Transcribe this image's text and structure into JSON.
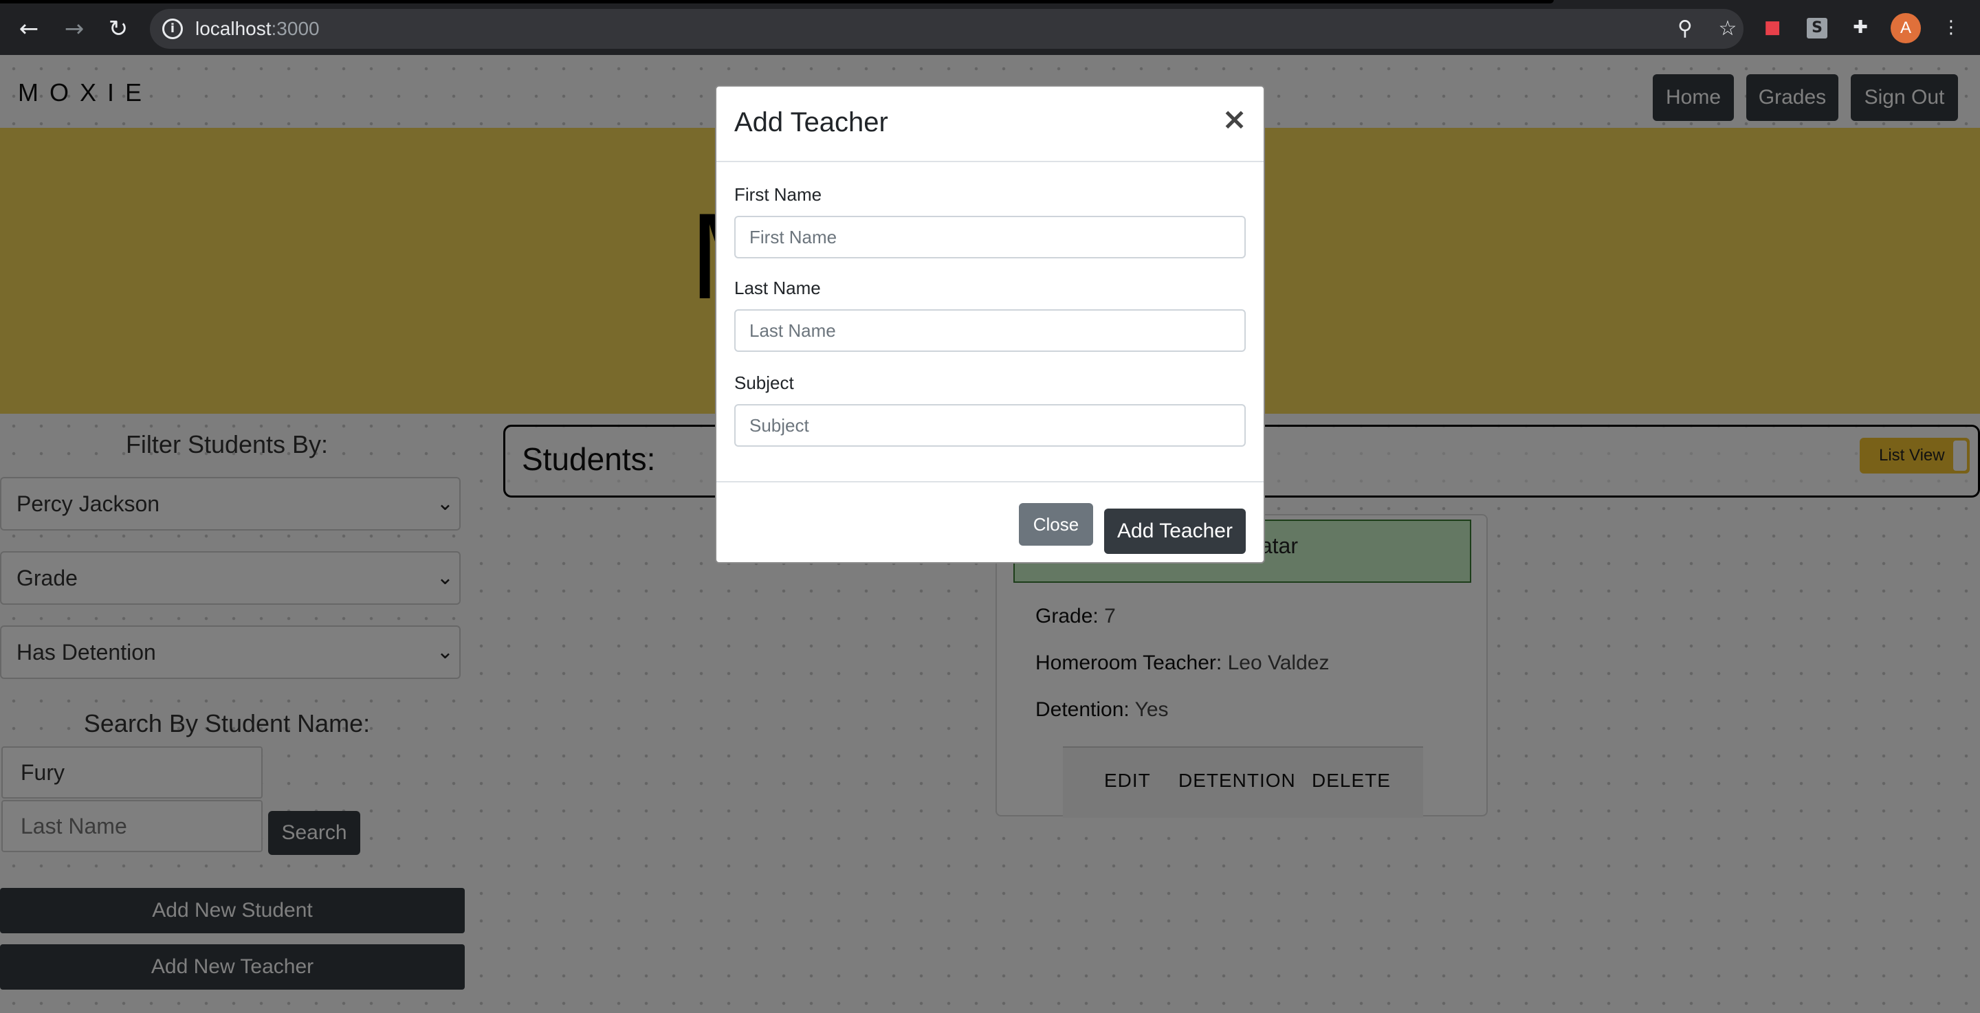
{
  "browser": {
    "url_host": "localhost",
    "url_port": ":3000",
    "profile_initial": "A",
    "ext_s_label": "S"
  },
  "navbar": {
    "brand": "MOXIE",
    "links": [
      "Home",
      "Grades",
      "Sign Out"
    ]
  },
  "hero": {
    "title": "MOXIE"
  },
  "filters": {
    "heading": "Filter Students By:",
    "selects": [
      "Percy Jackson",
      "Grade",
      "Has Detention"
    ],
    "search_heading": "Search By Student Name:",
    "first_name_value": "Fury",
    "last_name_placeholder": "Last Name",
    "search_label": "Search",
    "add_student_label": "Add New Student",
    "add_teacher_label": "Add New Teacher"
  },
  "students": {
    "title": "Students:",
    "toggle_label": "List View",
    "card": {
      "name": "atar",
      "grade_label": "Grade:",
      "grade_value": "7",
      "homeroom_label": "Homeroom Teacher:",
      "homeroom_value": "Leo Valdez",
      "detention_label": "Detention:",
      "detention_value": "Yes",
      "actions": [
        "EDIT",
        "DETENTION",
        "DELETE"
      ]
    }
  },
  "modal": {
    "title": "Add Teacher",
    "close_symbol": "×",
    "fields": [
      {
        "label": "First Name",
        "placeholder": "First Name"
      },
      {
        "label": "Last Name",
        "placeholder": "Last Name"
      },
      {
        "label": "Subject",
        "placeholder": "Subject"
      }
    ],
    "close_label": "Close",
    "submit_label": "Add Teacher"
  }
}
